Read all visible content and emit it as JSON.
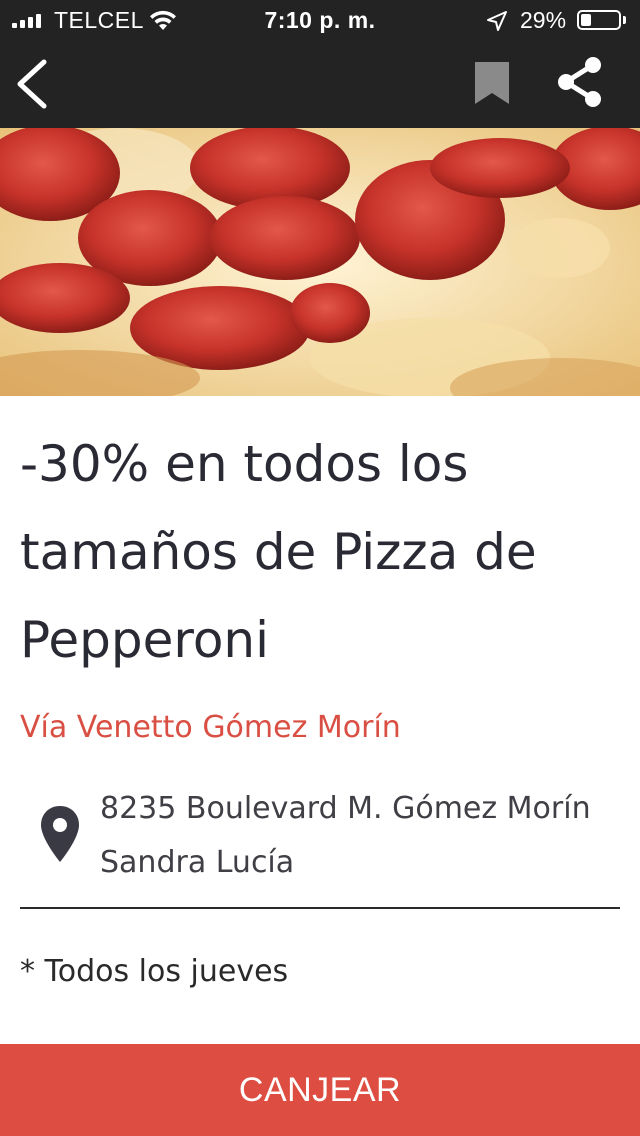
{
  "status_bar": {
    "carrier": "TELCEL",
    "time": "7:10 p. m.",
    "battery_percent": "29%",
    "battery_level": 0.29,
    "icons": [
      "signal-icon",
      "wifi-icon",
      "location-arrow-icon",
      "battery-icon"
    ]
  },
  "nav_bar": {
    "icons": [
      "back-chevron-icon",
      "bookmark-icon",
      "share-icon"
    ]
  },
  "hero": {
    "image": "pepperoni-pizza-photo"
  },
  "offer": {
    "title": "-30% en todos los tamaños de Pizza de Pepperoni",
    "venue": "Vía Venetto Gómez Morín",
    "address": "8235 Boulevard M. Gómez Morín Sandra Lucía",
    "note": "* Todos los jueves"
  },
  "action": {
    "redeem_label": "CANJEAR"
  },
  "colors": {
    "header_bg": "#232323",
    "accent": "#de4d41",
    "venue_text": "#d94f43",
    "title_text": "#2a2a35"
  }
}
